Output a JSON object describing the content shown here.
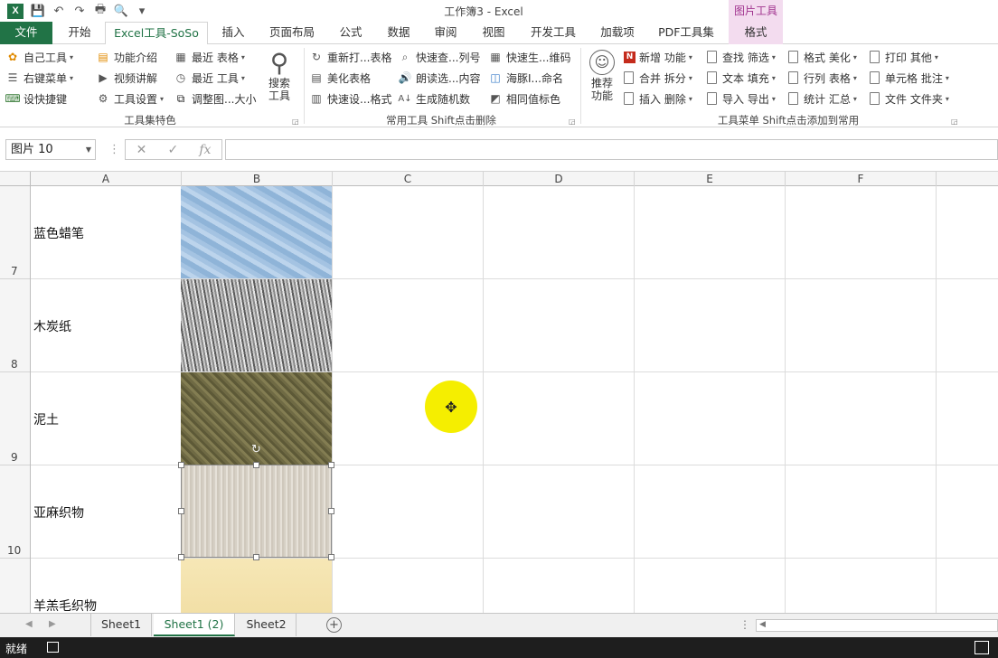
{
  "window": {
    "title": "工作簿3 - Excel",
    "context_tools": "图片工具",
    "app_logo": "X"
  },
  "quick_access": {
    "icons": [
      "excel-logo",
      "save-icon",
      "undo-icon",
      "redo-icon",
      "print-icon",
      "print-preview-icon",
      "customize-icon"
    ],
    "glyphs": [
      "💾",
      "↶",
      "↷",
      "🖶",
      "🔍",
      "▾"
    ]
  },
  "tabs": [
    {
      "label": "文件",
      "active": false
    },
    {
      "label": "开始",
      "active": false
    },
    {
      "label": "Excel工具-SoSo",
      "active": true
    },
    {
      "label": "插入",
      "active": false
    },
    {
      "label": "页面布局",
      "active": false
    },
    {
      "label": "公式",
      "active": false
    },
    {
      "label": "数据",
      "active": false
    },
    {
      "label": "审阅",
      "active": false
    },
    {
      "label": "视图",
      "active": false
    },
    {
      "label": "开发工具",
      "active": false
    },
    {
      "label": "加载项",
      "active": false
    },
    {
      "label": "PDF工具集",
      "active": false
    },
    {
      "label": "格式",
      "active": false
    }
  ],
  "ribbon": {
    "group1": {
      "label": "工具集特色",
      "items": [
        "自己工具",
        "右键菜单",
        "设快捷键",
        "功能介绍",
        "视频讲解",
        "工具设置",
        "最近  表格",
        "最近  工具",
        "调整图...大小"
      ],
      "big_button": "搜索\n工具"
    },
    "group2": {
      "label": "常用工具 Shift点击删除",
      "items": [
        "重新打...表格",
        "美化表格",
        "快速设...格式",
        "快速查...列号",
        "朗读选...内容",
        "生成随机数",
        "快速生...维码",
        "海豚I...命名",
        "相同值标色"
      ]
    },
    "group3": {
      "label": "工具菜单 Shift点击添加到常用",
      "big_button": "推荐\n功能",
      "items": [
        "新增 功能",
        "合并 拆分",
        "插入 删除",
        "查找 筛选",
        "文本 填充",
        "导入 导出",
        "格式 美化",
        "行列 表格",
        "统计 汇总",
        "打印 其他",
        "单元格 批注",
        "文件 文件夹"
      ]
    }
  },
  "formula_bar": {
    "name_box": "图片 10",
    "fx": "fx",
    "cancel": "✕",
    "enter": "✓",
    "value": ""
  },
  "columns": [
    "A",
    "B",
    "C",
    "D",
    "E",
    "F"
  ],
  "rows": [
    {
      "number": "7",
      "a": "蓝色蜡笔"
    },
    {
      "number": "8",
      "a": "木炭纸"
    },
    {
      "number": "9",
      "a": "泥土"
    },
    {
      "number": "10",
      "a": "亚麻织物"
    },
    {
      "number": "",
      "a": "羊羔毛织物"
    }
  ],
  "sheets": [
    {
      "name": "Sheet1",
      "active": false
    },
    {
      "name": "Sheet1 (2)",
      "active": true
    },
    {
      "name": "Sheet2",
      "active": false
    }
  ],
  "status": {
    "text": "就绪"
  },
  "colors": {
    "excel_green": "#217346",
    "context_pink": "#f3dcef",
    "cursor_yellow": "#f5ee00"
  }
}
